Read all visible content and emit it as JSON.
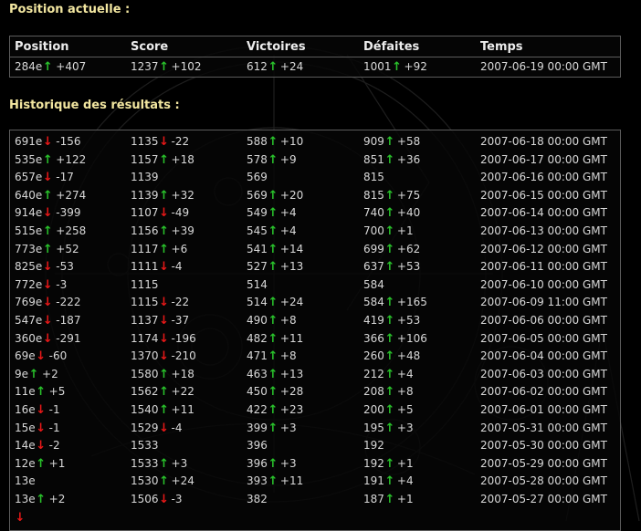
{
  "current": {
    "title": "Position actuelle :",
    "headers": [
      "Position",
      "Score",
      "Victoires",
      "Défaites",
      "Temps"
    ],
    "row": {
      "pos": "284e",
      "pos_dir": "up",
      "pos_d": "+407",
      "score": "1237",
      "score_dir": "up",
      "score_d": "+102",
      "wins": "612",
      "wins_dir": "up",
      "wins_d": "+24",
      "losses": "1001",
      "losses_dir": "up",
      "losses_d": "+92",
      "time": "2007-06-19 00:00 GMT"
    }
  },
  "history": {
    "title": "Historique des résultats :",
    "rows": [
      {
        "pos": "691e",
        "pos_dir": "down",
        "pos_d": "-156",
        "score": "1135",
        "score_dir": "down",
        "score_d": "-22",
        "wins": "588",
        "wins_dir": "up",
        "wins_d": "+10",
        "losses": "909",
        "losses_dir": "up",
        "losses_d": "+58",
        "time": "2007-06-18 00:00 GMT"
      },
      {
        "pos": "535e",
        "pos_dir": "up",
        "pos_d": "+122",
        "score": "1157",
        "score_dir": "up",
        "score_d": "+18",
        "wins": "578",
        "wins_dir": "up",
        "wins_d": "+9",
        "losses": "851",
        "losses_dir": "up",
        "losses_d": "+36",
        "time": "2007-06-17 00:00 GMT"
      },
      {
        "pos": "657e",
        "pos_dir": "down",
        "pos_d": "-17",
        "score": "1139",
        "score_dir": "",
        "score_d": "",
        "wins": "569",
        "wins_dir": "",
        "wins_d": "",
        "losses": "815",
        "losses_dir": "",
        "losses_d": "",
        "time": "2007-06-16 00:00 GMT"
      },
      {
        "pos": "640e",
        "pos_dir": "up",
        "pos_d": "+274",
        "score": "1139",
        "score_dir": "up",
        "score_d": "+32",
        "wins": "569",
        "wins_dir": "up",
        "wins_d": "+20",
        "losses": "815",
        "losses_dir": "up",
        "losses_d": "+75",
        "time": "2007-06-15 00:00 GMT"
      },
      {
        "pos": "914e",
        "pos_dir": "down",
        "pos_d": "-399",
        "score": "1107",
        "score_dir": "down",
        "score_d": "-49",
        "wins": "549",
        "wins_dir": "up",
        "wins_d": "+4",
        "losses": "740",
        "losses_dir": "up",
        "losses_d": "+40",
        "time": "2007-06-14 00:00 GMT"
      },
      {
        "pos": "515e",
        "pos_dir": "up",
        "pos_d": "+258",
        "score": "1156",
        "score_dir": "up",
        "score_d": "+39",
        "wins": "545",
        "wins_dir": "up",
        "wins_d": "+4",
        "losses": "700",
        "losses_dir": "up",
        "losses_d": "+1",
        "time": "2007-06-13 00:00 GMT"
      },
      {
        "pos": "773e",
        "pos_dir": "up",
        "pos_d": "+52",
        "score": "1117",
        "score_dir": "up",
        "score_d": "+6",
        "wins": "541",
        "wins_dir": "up",
        "wins_d": "+14",
        "losses": "699",
        "losses_dir": "up",
        "losses_d": "+62",
        "time": "2007-06-12 00:00 GMT"
      },
      {
        "pos": "825e",
        "pos_dir": "down",
        "pos_d": "-53",
        "score": "1111",
        "score_dir": "down",
        "score_d": "-4",
        "wins": "527",
        "wins_dir": "up",
        "wins_d": "+13",
        "losses": "637",
        "losses_dir": "up",
        "losses_d": "+53",
        "time": "2007-06-11 00:00 GMT"
      },
      {
        "pos": "772e",
        "pos_dir": "down",
        "pos_d": "-3",
        "score": "1115",
        "score_dir": "",
        "score_d": "",
        "wins": "514",
        "wins_dir": "",
        "wins_d": "",
        "losses": "584",
        "losses_dir": "",
        "losses_d": "",
        "time": "2007-06-10 00:00 GMT"
      },
      {
        "pos": "769e",
        "pos_dir": "down",
        "pos_d": "-222",
        "score": "1115",
        "score_dir": "down",
        "score_d": "-22",
        "wins": "514",
        "wins_dir": "up",
        "wins_d": "+24",
        "losses": "584",
        "losses_dir": "up",
        "losses_d": "+165",
        "time": "2007-06-09 11:00 GMT"
      },
      {
        "pos": "547e",
        "pos_dir": "down",
        "pos_d": "-187",
        "score": "1137",
        "score_dir": "down",
        "score_d": "-37",
        "wins": "490",
        "wins_dir": "up",
        "wins_d": "+8",
        "losses": "419",
        "losses_dir": "up",
        "losses_d": "+53",
        "time": "2007-06-06 00:00 GMT"
      },
      {
        "pos": "360e",
        "pos_dir": "down",
        "pos_d": "-291",
        "score": "1174",
        "score_dir": "down",
        "score_d": "-196",
        "wins": "482",
        "wins_dir": "up",
        "wins_d": "+11",
        "losses": "366",
        "losses_dir": "up",
        "losses_d": "+106",
        "time": "2007-06-05 00:00 GMT"
      },
      {
        "pos": "69e",
        "pos_dir": "down",
        "pos_d": "-60",
        "score": "1370",
        "score_dir": "down",
        "score_d": "-210",
        "wins": "471",
        "wins_dir": "up",
        "wins_d": "+8",
        "losses": "260",
        "losses_dir": "up",
        "losses_d": "+48",
        "time": "2007-06-04 00:00 GMT"
      },
      {
        "pos": "9e",
        "pos_dir": "up",
        "pos_d": "+2",
        "score": "1580",
        "score_dir": "up",
        "score_d": "+18",
        "wins": "463",
        "wins_dir": "up",
        "wins_d": "+13",
        "losses": "212",
        "losses_dir": "up",
        "losses_d": "+4",
        "time": "2007-06-03 00:00 GMT"
      },
      {
        "pos": "11e",
        "pos_dir": "up",
        "pos_d": "+5",
        "score": "1562",
        "score_dir": "up",
        "score_d": "+22",
        "wins": "450",
        "wins_dir": "up",
        "wins_d": "+28",
        "losses": "208",
        "losses_dir": "up",
        "losses_d": "+8",
        "time": "2007-06-02 00:00 GMT"
      },
      {
        "pos": "16e",
        "pos_dir": "down",
        "pos_d": "-1",
        "score": "1540",
        "score_dir": "up",
        "score_d": "+11",
        "wins": "422",
        "wins_dir": "up",
        "wins_d": "+23",
        "losses": "200",
        "losses_dir": "up",
        "losses_d": "+5",
        "time": "2007-06-01 00:00 GMT"
      },
      {
        "pos": "15e",
        "pos_dir": "down",
        "pos_d": "-1",
        "score": "1529",
        "score_dir": "down",
        "score_d": "-4",
        "wins": "399",
        "wins_dir": "up",
        "wins_d": "+3",
        "losses": "195",
        "losses_dir": "up",
        "losses_d": "+3",
        "time": "2007-05-31 00:00 GMT"
      },
      {
        "pos": "14e",
        "pos_dir": "down",
        "pos_d": "-2",
        "score": "1533",
        "score_dir": "",
        "score_d": "",
        "wins": "396",
        "wins_dir": "",
        "wins_d": "",
        "losses": "192",
        "losses_dir": "",
        "losses_d": "",
        "time": "2007-05-30 00:00 GMT"
      },
      {
        "pos": "12e",
        "pos_dir": "up",
        "pos_d": "+1",
        "score": "1533",
        "score_dir": "up",
        "score_d": "+3",
        "wins": "396",
        "wins_dir": "up",
        "wins_d": "+3",
        "losses": "192",
        "losses_dir": "up",
        "losses_d": "+1",
        "time": "2007-05-29 00:00 GMT"
      },
      {
        "pos": "13e",
        "pos_dir": "",
        "pos_d": "",
        "score": "1530",
        "score_dir": "up",
        "score_d": "+24",
        "wins": "393",
        "wins_dir": "up",
        "wins_d": "+11",
        "losses": "191",
        "losses_dir": "up",
        "losses_d": "+4",
        "time": "2007-05-28 00:00 GMT"
      },
      {
        "pos": "13e",
        "pos_dir": "up",
        "pos_d": "+2",
        "score": "1506",
        "score_dir": "down",
        "score_d": "-3",
        "wins": "382",
        "wins_dir": "",
        "wins_d": "",
        "losses": "187",
        "losses_dir": "up",
        "losses_d": "+1",
        "time": "2007-05-27 00:00 GMT"
      },
      {
        "pos": "",
        "pos_dir": "down",
        "pos_d": "",
        "score": "",
        "score_dir": "",
        "score_d": "",
        "wins": "",
        "wins_dir": "",
        "wins_d": "",
        "losses": "",
        "losses_dir": "",
        "losses_d": "",
        "time": ""
      }
    ]
  },
  "colors": {
    "background": "#000000",
    "title": "#f2e6a0",
    "text": "#d8d8d8",
    "up": "#29c22b",
    "down": "#e81818",
    "border": "#5c5c5c"
  },
  "icons": {
    "up": "arrow-up-icon",
    "down": "arrow-down-icon"
  }
}
